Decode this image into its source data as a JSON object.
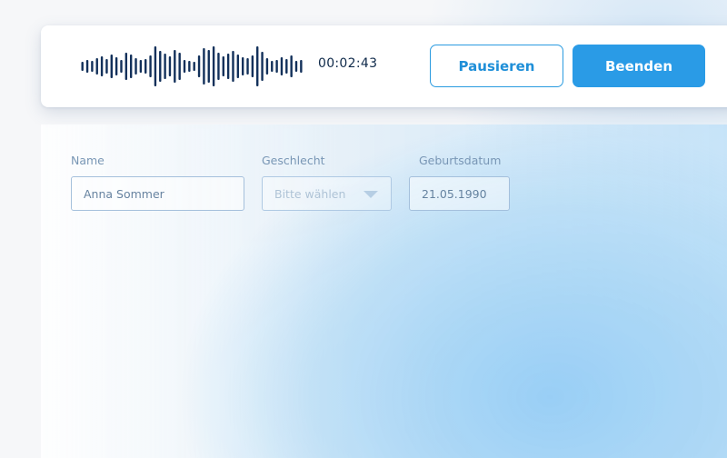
{
  "recorder": {
    "timer": "00:02:43",
    "pause_label": "Pausieren",
    "stop_label": "Beenden",
    "waveform_icon": "audio-waveform",
    "colors": {
      "waveform": "#12305a",
      "accent": "#2a9be6",
      "accent_text": "#1f8fd8"
    }
  },
  "form": {
    "fields": [
      {
        "label": "Name",
        "value": "Anna Sommer",
        "placeholder": ""
      },
      {
        "label": "Geschlecht",
        "value": "Bitte wählen",
        "placeholder": "Bitte wählen"
      },
      {
        "label": "Geburtsdatum",
        "value": "21.05.1990",
        "placeholder": ""
      }
    ]
  }
}
